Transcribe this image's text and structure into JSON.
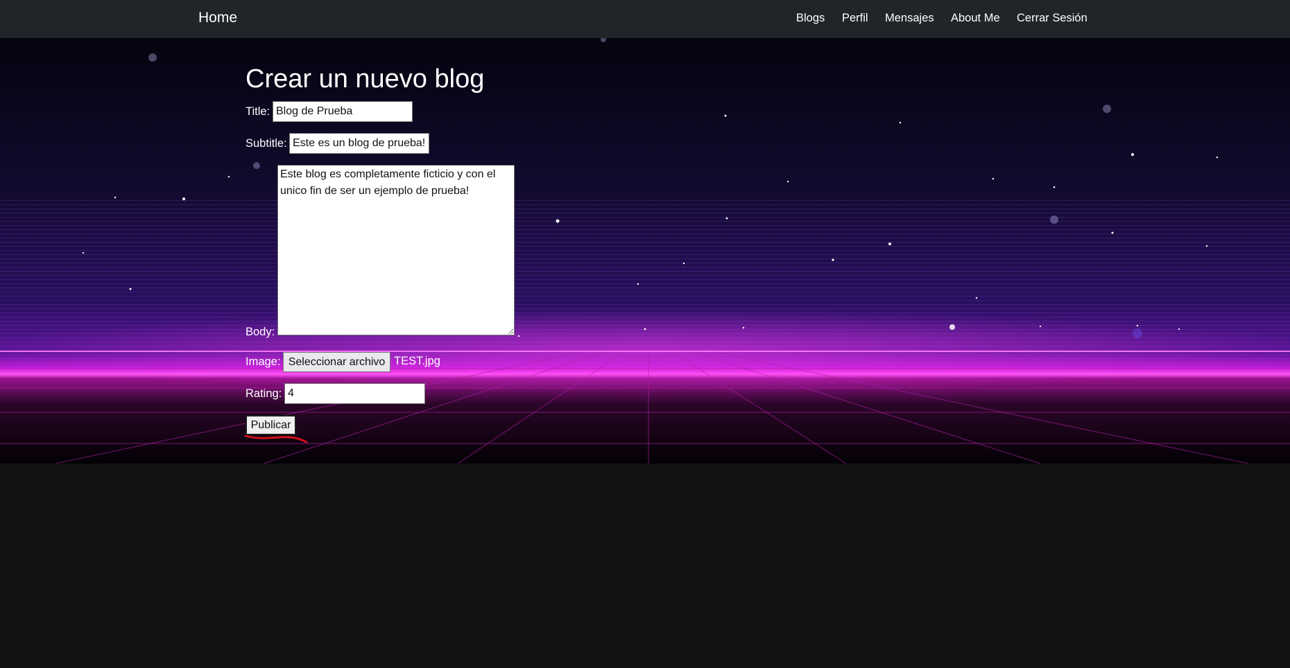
{
  "navbar": {
    "brand": "Home",
    "links": [
      "Blogs",
      "Perfil",
      "Mensajes",
      "About Me",
      "Cerrar Sesión"
    ]
  },
  "form": {
    "heading": "Crear un nuevo blog",
    "title_label": "Title:",
    "title_value": "Blog de Prueba",
    "subtitle_label": "Subtitle:",
    "subtitle_value": "Este es un blog de prueba!",
    "body_label": "Body:",
    "body_value": "Este blog es completamente ficticio y con el unico fin de ser un ejemplo de prueba!",
    "image_label": "Image:",
    "file_button_label": "Seleccionar archivo",
    "file_name": "TEST.jpg",
    "rating_label": "Rating:",
    "rating_value": "4",
    "submit_label": "Publicar"
  },
  "colors": {
    "navbar_bg": "#212529",
    "page_bg": "#121212",
    "horizon_glow": "#ff2bf0",
    "grid_line": "#b01fa8",
    "annotation": "#d0101a"
  }
}
